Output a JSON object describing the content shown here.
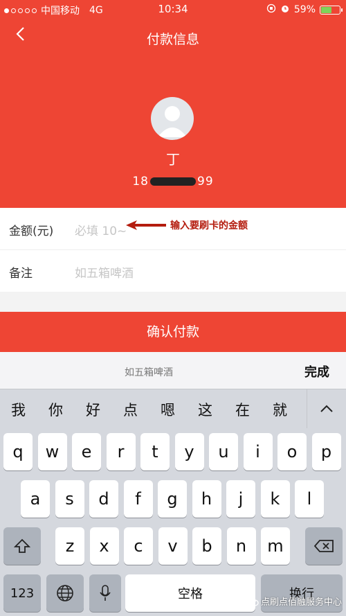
{
  "status": {
    "carrier": "中国移动",
    "network": "4G",
    "time": "10:34",
    "battery": "59%",
    "battery_level": 0.59
  },
  "header": {
    "title": "付款信息",
    "back": "<"
  },
  "payee": {
    "name": "丁",
    "phone_start": "18",
    "phone_end": "99"
  },
  "form": {
    "amount_label": "金额(元)",
    "amount_placeholder": "必填 10~",
    "note_label": "备注",
    "note_placeholder": "如五箱啤酒"
  },
  "annotation": "输入要刷卡的金额",
  "confirm_label": "确认付款",
  "keyboard": {
    "preview": "如五箱啤酒",
    "done": "完成",
    "candidates": [
      "我",
      "你",
      "好",
      "点",
      "嗯",
      "这",
      "在",
      "就"
    ],
    "row1": [
      "q",
      "w",
      "e",
      "r",
      "t",
      "y",
      "u",
      "i",
      "o",
      "p"
    ],
    "row2": [
      "a",
      "s",
      "d",
      "f",
      "g",
      "h",
      "j",
      "k",
      "l"
    ],
    "row3": [
      "z",
      "x",
      "c",
      "v",
      "b",
      "n",
      "m"
    ],
    "num": "123",
    "space": "空格",
    "enter": "换行"
  },
  "watermark": "点刷点佰融服务中心",
  "colors": {
    "brand": "#ee4534",
    "annotation": "#b41c0e"
  }
}
